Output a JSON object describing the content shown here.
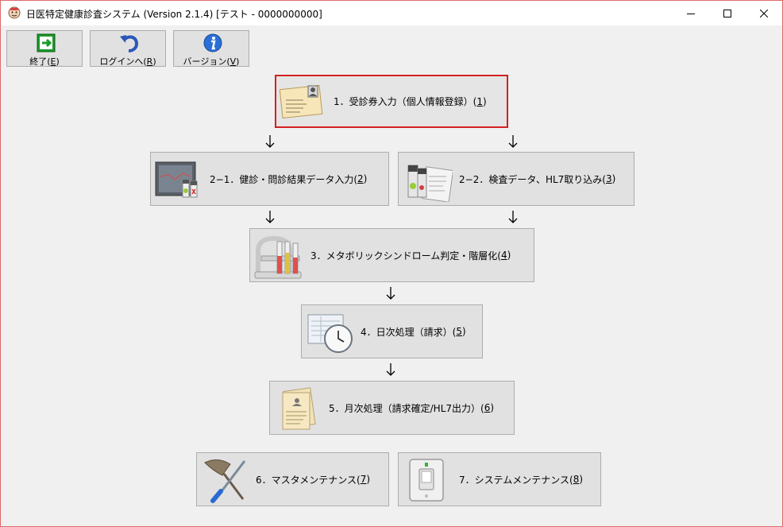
{
  "window": {
    "title": "日医特定健康診査システム (Version 2.1.4) [テスト - 0000000000]"
  },
  "toolbar": {
    "exit": {
      "text": "終了(",
      "key": "E",
      "tail": ")"
    },
    "login": {
      "text": "ログインへ(",
      "key": "R",
      "tail": ")"
    },
    "version": {
      "text": "バージョン(",
      "key": "V",
      "tail": ")"
    }
  },
  "menu": {
    "reception": {
      "text": "1．受診券入力（個人情報登録）(",
      "key": "1",
      "tail": ")"
    },
    "exam_entry": {
      "text": "2−1．健診・問診結果データ入力(",
      "key": "2",
      "tail": ")"
    },
    "lab_import": {
      "text": "2−2．検査データ、HL7取り込み(",
      "key": "3",
      "tail": ")"
    },
    "metabolic": {
      "text": "3．メタボリックシンドローム判定・階層化(",
      "key": "4",
      "tail": ")"
    },
    "daily": {
      "text": "4．日次処理（請求）(",
      "key": "5",
      "tail": ")"
    },
    "monthly": {
      "text": "5．月次処理（請求確定/HL7出力）(",
      "key": "6",
      "tail": ")"
    },
    "master": {
      "text": "6．マスタメンテナンス(",
      "key": "7",
      "tail": ")"
    },
    "system": {
      "text": "7．システムメンテナンス(",
      "key": "8",
      "tail": ")"
    }
  },
  "colors": {
    "selected_border": "#d32020",
    "button_face": "#e1e1e1",
    "window_bg": "#f0f0f0"
  },
  "icons": {
    "exit": "exit-door-icon",
    "login": "undo-arrow-icon",
    "version": "info-icon",
    "reception": "id-card-icon",
    "exam_entry": "monitor-vials-icon",
    "lab_import": "vials-report-icon",
    "metabolic": "test-tube-rack-icon",
    "daily": "ledger-clock-icon",
    "monthly": "documents-icon",
    "master": "duster-screwdriver-icon",
    "system": "switch-plate-icon"
  }
}
